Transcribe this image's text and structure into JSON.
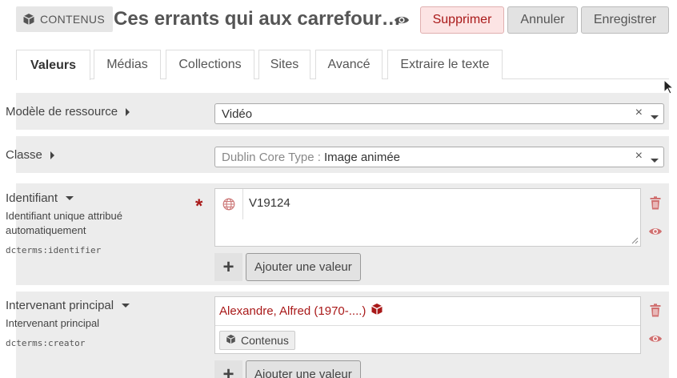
{
  "header": {
    "badge_label": "CONTENUS",
    "title": "Ces errants qui aux carrefour…",
    "buttons": {
      "delete": "Supprimer",
      "cancel": "Annuler",
      "save": "Enregistrer"
    }
  },
  "tabs": [
    {
      "label": "Valeurs",
      "active": true
    },
    {
      "label": "Médias"
    },
    {
      "label": "Collections"
    },
    {
      "label": "Sites"
    },
    {
      "label": "Avancé"
    },
    {
      "label": "Extraire le texte"
    }
  ],
  "fields": {
    "resource_template": {
      "label": "Modèle de ressource",
      "value": "Vidéo",
      "clear": "×"
    },
    "class": {
      "label": "Classe",
      "prefix": "Dublin Core Type :",
      "value": "Image animée",
      "clear": "×"
    },
    "identifier": {
      "label": "Identifiant",
      "description_line1": "Identifiant unique attribué",
      "description_line2": "automatiquement",
      "term": "dcterms:identifier",
      "required_mark": "*",
      "value": "V19124",
      "add_symbol": "+",
      "add_label": "Ajouter une valeur"
    },
    "creator": {
      "label": "Intervenant principal",
      "description": "Intervenant principal",
      "term": "dcterms:creator",
      "value": "Alexandre, Alfred (1970-....)",
      "chip_label": "Contenus",
      "add_symbol": "+",
      "add_label": "Ajouter une valeur"
    }
  },
  "colors": {
    "danger": "#a91919",
    "panel": "#ececec",
    "button": "#e2e2e2"
  },
  "icons": [
    "cube-icon",
    "eye-icon",
    "globe-icon",
    "trash-icon",
    "caret-right-icon",
    "caret-down-icon",
    "mouse-cursor-icon"
  ]
}
